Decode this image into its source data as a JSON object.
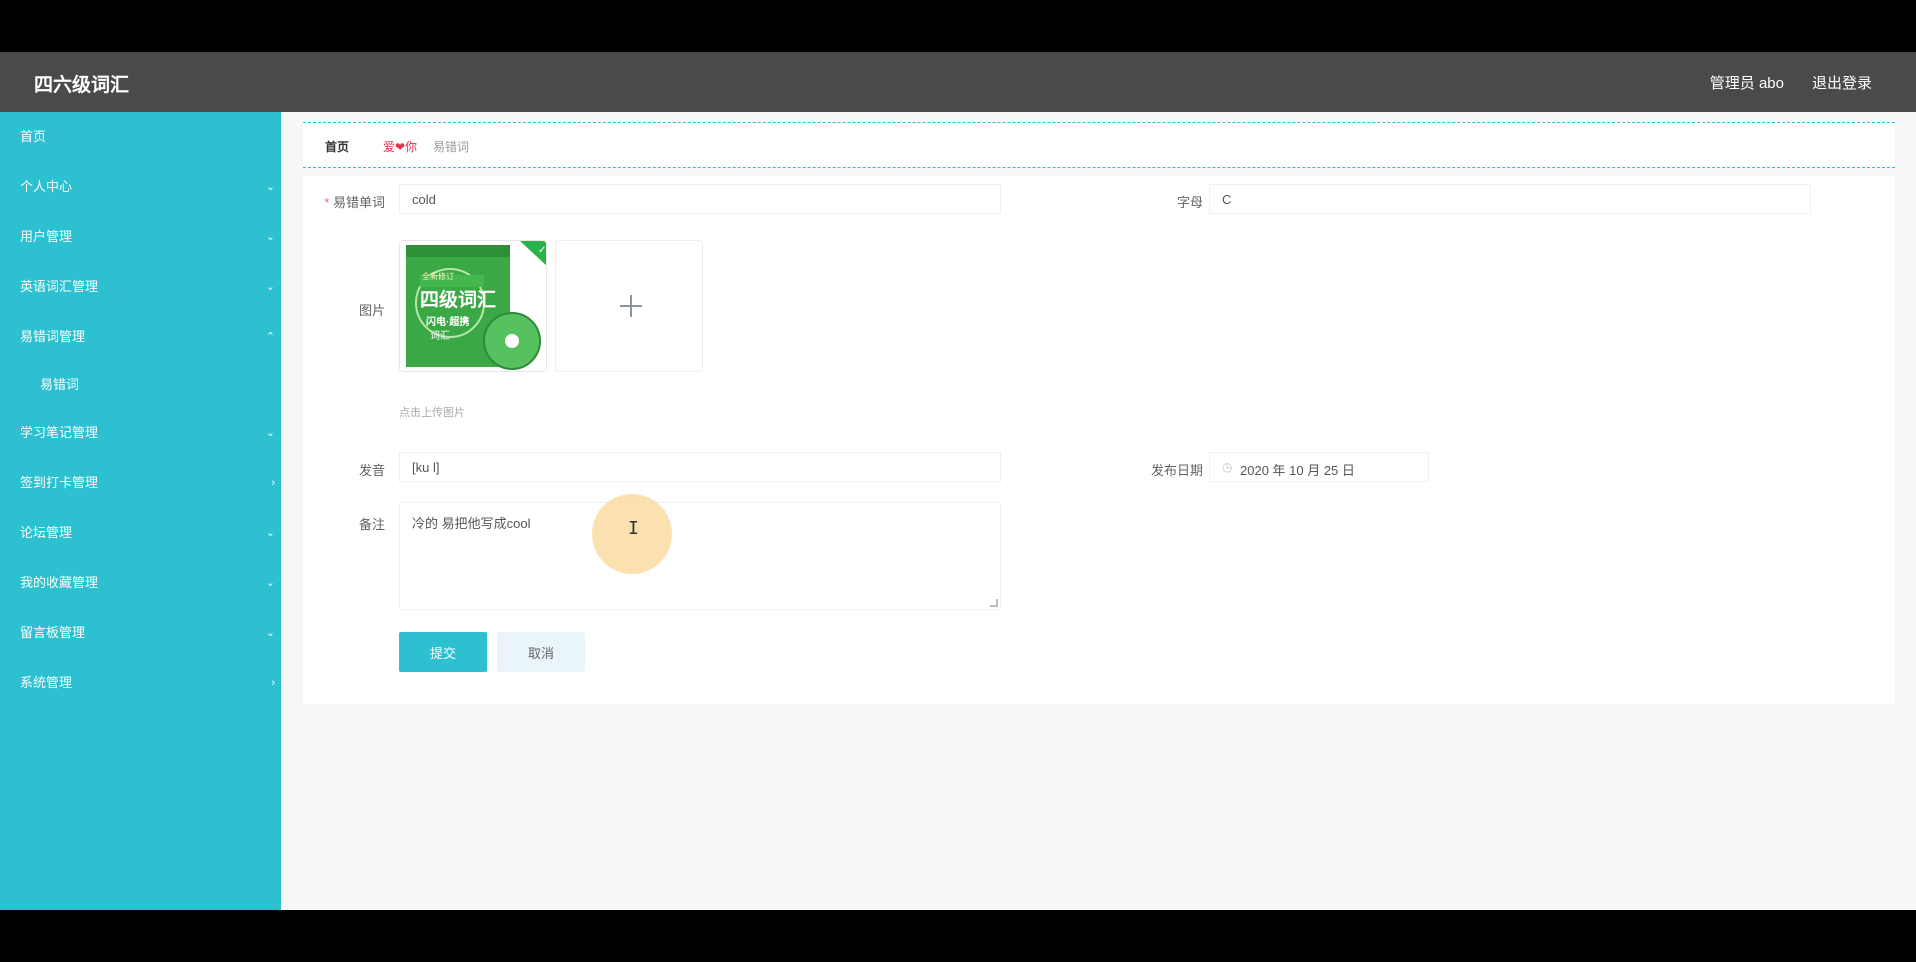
{
  "app": {
    "brand": "四六级词汇",
    "user_label": "管理员 abo",
    "logout_label": "退出登录"
  },
  "sidebar": {
    "items": [
      {
        "label": "首页",
        "arrow": ""
      },
      {
        "label": "个人中心",
        "arrow": "⌄"
      },
      {
        "label": "用户管理",
        "arrow": "⌄"
      },
      {
        "label": "英语词汇管理",
        "arrow": "⌄"
      },
      {
        "label": "易错词管理",
        "arrow": "⌃"
      },
      {
        "label": "学习笔记管理",
        "arrow": "⌄"
      },
      {
        "label": "签到打卡管理",
        "arrow": "›"
      },
      {
        "label": "论坛管理",
        "arrow": "⌄"
      },
      {
        "label": "我的收藏管理",
        "arrow": "⌄"
      },
      {
        "label": "留言板管理",
        "arrow": "⌄"
      },
      {
        "label": "系统管理",
        "arrow": "›"
      }
    ],
    "sub_items": [
      {
        "label": "易错词"
      }
    ]
  },
  "breadcrumb": {
    "home": "首页",
    "separator": "爱❤你",
    "current": "易错词"
  },
  "form": {
    "word_label": "易错单词",
    "word_value": "cold",
    "letter_label": "字母",
    "letter_value": "C",
    "image_label": "图片",
    "image_tip": "点击上传图片",
    "thumb_title_small": "全新修订",
    "thumb_title": "四级词汇",
    "thumb_subtitle": "闪电·超携",
    "thumb_subtitle2": "词汇",
    "pron_label": "发音",
    "pron_value": "[ku l]",
    "date_label": "发布日期",
    "date_value": "2020 年 10 月 25 日",
    "remark_label": "备注",
    "remark_value": "冷的 易把他写成cool",
    "submit_label": "提交",
    "cancel_label": "取消"
  },
  "colors": {
    "accent": "#2cc0d0",
    "topbar": "#4a4a4a",
    "heart": "#e0334d"
  },
  "icons": {
    "upload": "plus-icon",
    "date": "clock-icon",
    "cursor": "text-cursor-icon"
  }
}
